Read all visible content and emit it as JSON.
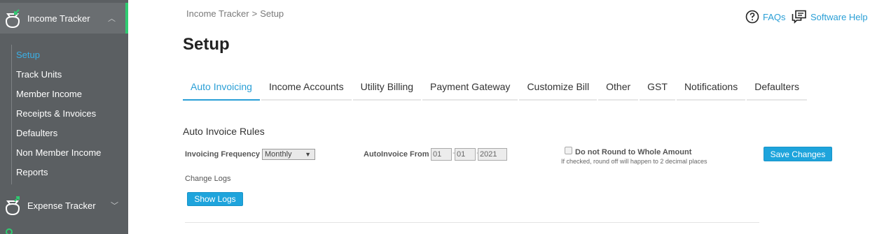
{
  "sidebar": {
    "sections": [
      {
        "label": "Income Tracker",
        "icon": "income-tracker-icon",
        "chevron": "chevron-up-icon"
      },
      {
        "label": "Expense Tracker",
        "icon": "expense-tracker-icon",
        "chevron": "chevron-down-icon"
      }
    ],
    "items": [
      {
        "label": "Setup",
        "active": true
      },
      {
        "label": "Track Units"
      },
      {
        "label": "Member Income"
      },
      {
        "label": "Receipts & Invoices"
      },
      {
        "label": "Defaulters"
      },
      {
        "label": "Non Member Income"
      },
      {
        "label": "Reports"
      }
    ],
    "accent_color": "#2ecc71"
  },
  "breadcrumb": {
    "parent": "Income Tracker",
    "separator": ">",
    "current": "Setup"
  },
  "help": {
    "faqs": "FAQs",
    "software_help": "Software Help"
  },
  "page_title": "Setup",
  "tabs": [
    "Auto Invoicing",
    "Income Accounts",
    "Utility Billing",
    "Payment Gateway",
    "Customize Bill",
    "Other",
    "GST",
    "Notifications",
    "Defaulters"
  ],
  "active_tab": "Auto Invoicing",
  "auto_invoice": {
    "title": "Auto Invoice Rules",
    "frequency_label": "Invoicing Frequency",
    "frequency_value": "Monthly",
    "from_label": "AutoInvoice From",
    "from_day": "01",
    "from_month": "01",
    "from_year": "2021",
    "round_label": "Do not Round to Whole Amount",
    "round_hint": "If checked, round off will happen to 2 decimal places",
    "round_checked": false,
    "save_button": "Save Changes",
    "change_logs_label": "Change Logs",
    "show_logs_button": "Show Logs"
  },
  "colors": {
    "link": "#2a9fd6",
    "button": "#1ea4dc",
    "sidebar_bg": "#5b5f62"
  }
}
